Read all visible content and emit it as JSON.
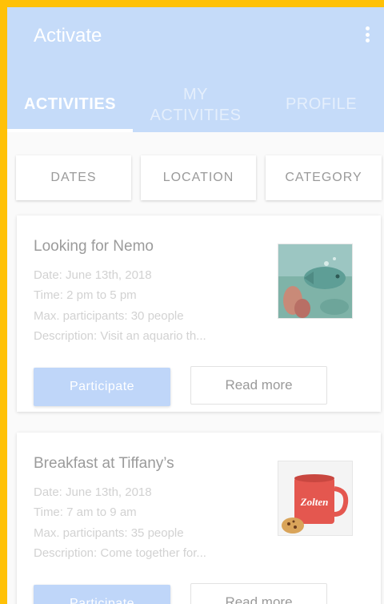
{
  "app": {
    "title": "Activate"
  },
  "tabs": [
    {
      "label": "ACTIVITIES",
      "active": true
    },
    {
      "label": "MY ACTIVITIES",
      "active": false
    },
    {
      "label": "PROFILE",
      "active": false
    }
  ],
  "filters": [
    {
      "label": "DATES"
    },
    {
      "label": "LOCATION"
    },
    {
      "label": "CATEGORY"
    }
  ],
  "activities": [
    {
      "title": "Looking for Nemo",
      "date": "Date: June 13th, 2018",
      "time": "Time: 2 pm to 5 pm",
      "participants": "Max. participants: 30 people",
      "description": "Description: Visit an aquario th...",
      "image": "aquarium-image",
      "participate_label": "Participate",
      "read_more_label": "Read more"
    },
    {
      "title": "Breakfast at Tiffany’s",
      "date": "Date: June 13th, 2018",
      "time": "Time: 7 am to 9 am",
      "participants": "Max. participants: 35 people",
      "description": "Description: Come together for...",
      "image": "coffee-mug-image",
      "image_text": "Zolten",
      "participate_label": "Participate",
      "read_more_label": "Read more"
    }
  ],
  "colors": {
    "frame": "#FFC107",
    "app_bar": "#C5DBF9",
    "primary_button": "#BFD6F9"
  }
}
